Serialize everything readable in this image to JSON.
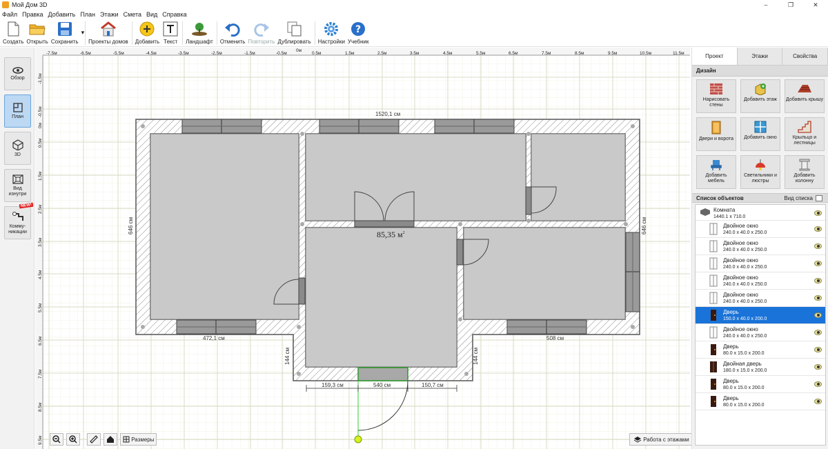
{
  "window": {
    "title": "Мой Дом 3D",
    "minimize": "–",
    "maximize": "❐",
    "close": "✕"
  },
  "menu": [
    "Файл",
    "Правка",
    "Добавить",
    "План",
    "Этажи",
    "Смета",
    "Вид",
    "Справка"
  ],
  "toolbar": [
    {
      "label": "Создать",
      "icon": "new-file-icon"
    },
    {
      "label": "Открыть",
      "icon": "open-folder-icon"
    },
    {
      "label": "Сохранить",
      "icon": "save-icon"
    },
    {
      "label": "Проекты домов",
      "icon": "house-projects-icon"
    },
    {
      "label": "Добавить",
      "icon": "add-icon"
    },
    {
      "label": "Текст",
      "icon": "text-icon"
    },
    {
      "label": "Ландшафт",
      "icon": "landscape-icon"
    },
    {
      "label": "Отменить",
      "icon": "undo-icon"
    },
    {
      "label": "Повторить",
      "icon": "redo-icon"
    },
    {
      "label": "Дублировать",
      "icon": "duplicate-icon"
    },
    {
      "label": "Настройки",
      "icon": "settings-icon"
    },
    {
      "label": "Учебник",
      "icon": "help-icon"
    }
  ],
  "save_dropdown": "▾",
  "left_nav": [
    {
      "label": "Обзор",
      "icon": "eye-icon"
    },
    {
      "label": "План",
      "icon": "plan-icon",
      "active": true
    },
    {
      "label": "3D",
      "icon": "cube-icon"
    },
    {
      "label": "Вид изнутри",
      "icon": "interior-view-icon"
    },
    {
      "label": "Комму-никации",
      "icon": "communications-icon",
      "badge": "NEW!"
    }
  ],
  "ruler": {
    "top": [
      "-7.5м",
      "-6.5м",
      "-5.5м",
      "-4.5м",
      "-3.5м",
      "-2.5м",
      "-1.5м",
      "-0.5м",
      "0м",
      "0.5м",
      "1.5м",
      "2.5м",
      "3.5м",
      "4.5м",
      "5.5м",
      "6.5м",
      "7.5м",
      "8.5м",
      "9.5м",
      "10.5м",
      "11.5м"
    ],
    "left": [
      "-1.5м",
      "-0.5м",
      "0м",
      "0.5м",
      "1.5м",
      "2.5м",
      "3.5м",
      "4.5м",
      "5.5м",
      "6.5м",
      "7.5м",
      "8.5м",
      "9.5м"
    ]
  },
  "plan": {
    "dim_top": "1520,1 см",
    "dim_left": "646 см",
    "dim_right": "646 см",
    "dim_bottom_left": "472,1 см",
    "dim_bottom_right": "508 см",
    "dim_porch_left": "144 см",
    "dim_porch_right": "144 см",
    "dim_door_left": "159,3 см",
    "dim_door_center": "540 см",
    "dim_door_right": "150,7 см",
    "area": "85,35 м",
    "area_sup": "2"
  },
  "bottom_tools": {
    "sizes_label": "Размеры",
    "floors_label": "Работа с этажами"
  },
  "right_panel": {
    "tabs": [
      "Проект",
      "Этажи",
      "Свойства"
    ],
    "design_title": "Дизайн",
    "design_buttons": [
      {
        "label": "Нарисовать стены",
        "icon": "brick-wall-icon"
      },
      {
        "label": "Добавить этаж",
        "icon": "add-floor-icon"
      },
      {
        "label": "Добавить крышу",
        "icon": "roof-icon"
      },
      {
        "label": "Двери и ворота",
        "icon": "door-icon"
      },
      {
        "label": "Добавить окно",
        "icon": "window-icon"
      },
      {
        "label": "Крыльцо и лестницы",
        "icon": "stairs-icon"
      },
      {
        "label": "Добавить мебель",
        "icon": "chair-icon"
      },
      {
        "label": "Светильники и люстры",
        "icon": "lamp-icon"
      },
      {
        "label": "Добавить колонну",
        "icon": "column-icon"
      }
    ],
    "objects_title": "Список объектов",
    "view_list_label": "Вид списка",
    "objects": [
      {
        "name": "Комната",
        "dims": "1440.1 x 710.0",
        "type": "room"
      },
      {
        "name": "Двойное окно",
        "dims": "240.0 x 40.0 x 250.0",
        "type": "window"
      },
      {
        "name": "Двойное окно",
        "dims": "240.0 x 40.0 x 250.0",
        "type": "window"
      },
      {
        "name": "Двойное окно",
        "dims": "240.0 x 40.0 x 250.0",
        "type": "window"
      },
      {
        "name": "Двойное окно",
        "dims": "240.0 x 40.0 x 250.0",
        "type": "window"
      },
      {
        "name": "Двойное окно",
        "dims": "240.0 x 40.0 x 250.0",
        "type": "window"
      },
      {
        "name": "Дверь",
        "dims": "150.0 x 40.0 x 200.0",
        "type": "door",
        "selected": true
      },
      {
        "name": "Двойное окно",
        "dims": "240.0 x 40.0 x 250.0",
        "type": "window"
      },
      {
        "name": "Дверь",
        "dims": "80.0 x 15.0 x 200.0",
        "type": "door"
      },
      {
        "name": "Двойная дверь",
        "dims": "180.0 x 15.0 x 200.0",
        "type": "door"
      },
      {
        "name": "Дверь",
        "dims": "80.0 x 15.0 x 200.0",
        "type": "door"
      },
      {
        "name": "Дверь",
        "dims": "80.0 x 15.0 x 200.0",
        "type": "door"
      }
    ]
  }
}
